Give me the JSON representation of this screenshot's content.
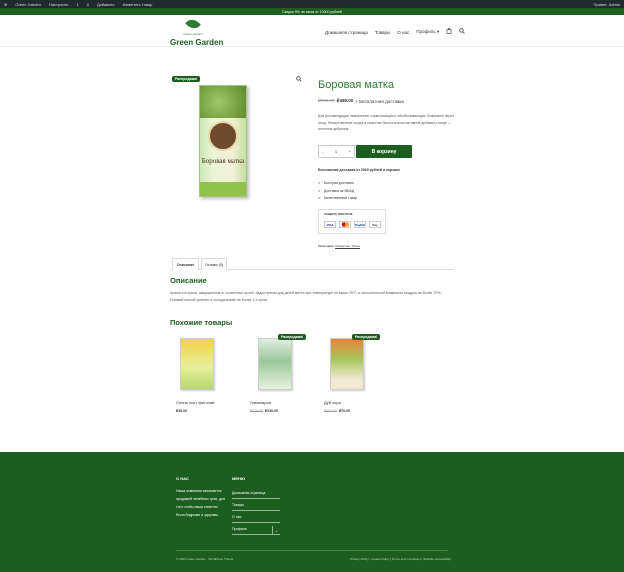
{
  "adminbar": {
    "items": [
      "Green Garden",
      "Настроить",
      "1",
      "0",
      "Добавить",
      "Изменить товар"
    ],
    "greeting": "Привет, Admin"
  },
  "promo": "Скидка 9% на заказ от 10000 рублей",
  "header": {
    "logo_small": "Green Garden",
    "site_title": "Green Garden",
    "nav": [
      "Домашняя страница",
      "Товары",
      "О нас",
      "Профиль ▾"
    ]
  },
  "product": {
    "sale_badge": "Распродажа!",
    "pack_name": "Боровая матка",
    "title": "Боровая матка",
    "old_price": "₽599.00",
    "new_price": "₽499.00",
    "shipping": "+ Бесплатная доставка",
    "description": "Для рекомендации назначения: гормонизация и обезболивающих. Возможно через плод. Лекарственное сырьё в качестве биологически активной добавки к пище — источник арбутина.",
    "qty_minus": "-",
    "qty_value": "1",
    "qty_plus": "+",
    "cart_button": "В корзину",
    "free_shipping_note": "Бесплатная доставка от 2000 рублей в корзине",
    "features": [
      "Быстрая доставка",
      "Доставка за МКАД",
      "Качественный товар"
    ],
    "secure_title": "ЗАЩИТА ПОКУПОК",
    "payments": [
      "VISA",
      "MC",
      "PayPal",
      "Pay"
    ],
    "categories_label": "Категории:",
    "categories_value": "Лекарства, Травы"
  },
  "tabs": [
    "Описание",
    "Отзывы (0)"
  ],
  "description_section": {
    "heading": "Описание",
    "text": "Хранить в сухом, защищенном от солнечных лучей, недоступном для детей месте при температуре не выше 25°С и относительной влажности воздуха не более 70%. Готовый настой хранить в холодильнике не более 2-х суток."
  },
  "related": {
    "heading": "Похожие товары",
    "items": [
      {
        "name": "Сенна лист фиточай",
        "old_price": "",
        "price": "₽45.00",
        "badge": ""
      },
      {
        "name": "Ламинария",
        "old_price": "₽179.00",
        "price": "₽139.00",
        "badge": "Распродажа!"
      },
      {
        "name": "Дуб кора",
        "old_price": "₽100.00",
        "price": "₽70.00",
        "badge": "Распродажа!"
      }
    ]
  },
  "footer": {
    "about_title": "О НАС",
    "about_text": "Наша компания занимается продажей лечебных трав, для того чтобы наши клиенты были бодрыми и здоровы.",
    "menu_title": "МЕНЮ",
    "menu": [
      "Домашняя страница",
      "Товары",
      "О нас",
      "Профиль"
    ],
    "menu_toggle": "⌄",
    "copyright": "© 2024 Green Garden · WordPress Theme",
    "legal": "Privacy Policy | Cookie Policy | Terms and Conditions | Website Accessibility"
  },
  "colors": {
    "brand": "#1b5e20",
    "title": "#2e7d32"
  }
}
